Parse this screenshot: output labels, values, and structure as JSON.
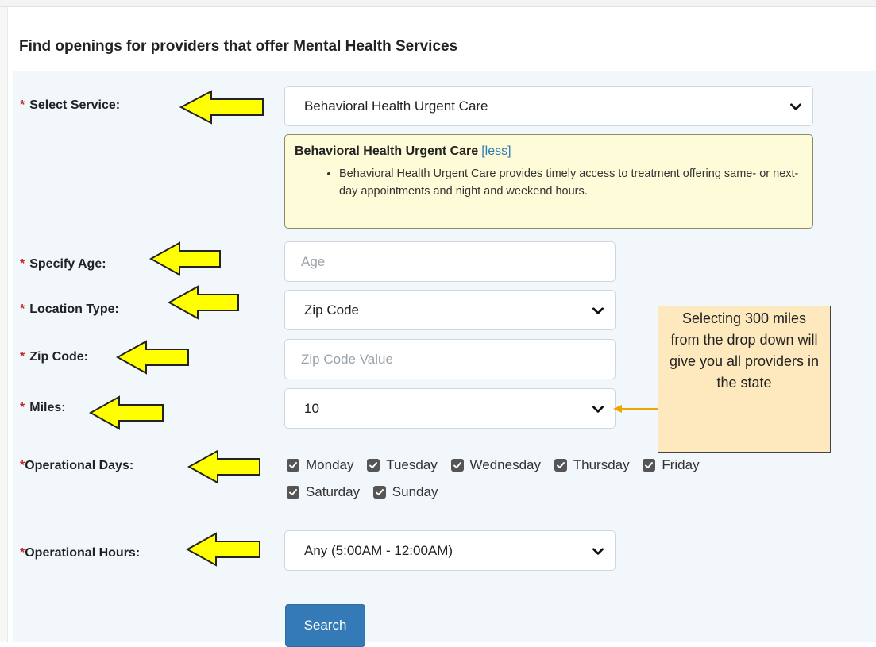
{
  "form": {
    "title": "Find openings for providers that offer Mental Health Services",
    "required_marker": "*",
    "labels": {
      "service": "Select Service:",
      "age": "Specify Age:",
      "location_type": "Location Type:",
      "zip": "Zip Code:",
      "miles": "Miles:",
      "days": "Operational Days:",
      "hours": "Operational Hours:"
    },
    "service": {
      "selected": "Behavioral Health Urgent Care"
    },
    "service_info": {
      "title": "Behavioral Health Urgent Care",
      "toggle": "[less]",
      "bullet": "Behavioral Health Urgent Care provides timely access to treatment offering same- or next-day appointments and night and weekend hours."
    },
    "age": {
      "placeholder": "Age",
      "value": ""
    },
    "location_type": {
      "selected": "Zip Code"
    },
    "zip": {
      "placeholder": "Zip Code Value",
      "value": ""
    },
    "miles": {
      "selected": "10"
    },
    "days": [
      {
        "label": "Monday",
        "checked": true
      },
      {
        "label": "Tuesday",
        "checked": true
      },
      {
        "label": "Wednesday",
        "checked": true
      },
      {
        "label": "Thursday",
        "checked": true
      },
      {
        "label": "Friday",
        "checked": true
      },
      {
        "label": "Saturday",
        "checked": true
      },
      {
        "label": "Sunday",
        "checked": true
      }
    ],
    "hours": {
      "selected": "Any (5:00AM - 12:00AM)"
    },
    "search_label": "Search"
  },
  "annotation": {
    "callout_text": "Selecting 300 miles from the drop down will give you all providers in the state"
  },
  "colors": {
    "arrow_fill": "#ffff00",
    "callout_fill": "#fde9bd",
    "callout_connector": "#f0a500",
    "button": "#337ab7",
    "info_box": "#fdfbd8",
    "required": "#c62828",
    "link": "#2e7bb5"
  }
}
